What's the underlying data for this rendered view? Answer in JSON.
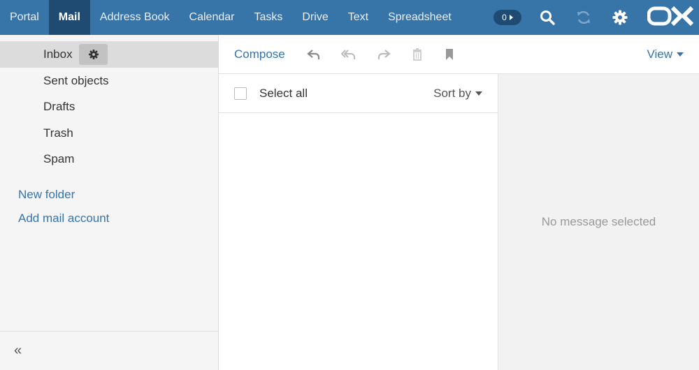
{
  "topbar": {
    "apps": [
      "Portal",
      "Mail",
      "Address Book",
      "Calendar",
      "Tasks",
      "Drive",
      "Text",
      "Spreadsheet"
    ],
    "active_app": "Mail",
    "notification_count": "0",
    "icons": [
      "search-icon",
      "refresh-icon",
      "gear-icon"
    ],
    "logo": "OX"
  },
  "sidebar": {
    "folders": [
      "Inbox",
      "Sent objects",
      "Drafts",
      "Trash",
      "Spam"
    ],
    "selected_folder": "Inbox",
    "new_folder": "New folder",
    "add_mail_account": "Add mail account",
    "collapse_symbol": "«"
  },
  "toolbar": {
    "compose": "Compose",
    "icons": [
      "reply-icon",
      "reply-all-icon",
      "forward-icon",
      "delete-icon",
      "bookmark-icon"
    ],
    "view": "View"
  },
  "list": {
    "select_all": "Select all",
    "sort_by": "Sort by"
  },
  "detail": {
    "empty_message": "No message selected"
  },
  "colors": {
    "topbar": "#3774a8",
    "topbar_active": "#1f4b73",
    "link": "#3774a8"
  }
}
